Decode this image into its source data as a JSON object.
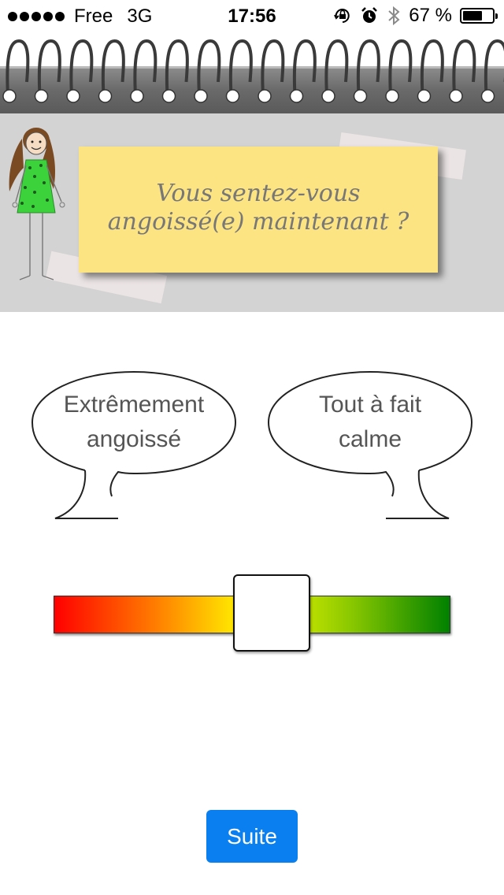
{
  "status_bar": {
    "carrier": "Free",
    "network": "3G",
    "time": "17:56",
    "battery_percent": "67 %",
    "battery_level": 0.67,
    "icons": [
      "orientation-lock-icon",
      "alarm-icon",
      "bluetooth-icon"
    ]
  },
  "question": {
    "line1": "Vous sentez-vous",
    "line2": "angoissé(e) maintenant ?"
  },
  "scale": {
    "left_label_line1": "Extrêmement",
    "left_label_line2": "angoissé",
    "right_label_line1": "Tout à fait",
    "right_label_line2": "calme",
    "value": 0.55,
    "colors": [
      "#ff0000",
      "#ff7a00",
      "#ffff00",
      "#8ac800",
      "#008000"
    ]
  },
  "actions": {
    "next_label": "Suite",
    "accent": "#0a7ff0"
  }
}
